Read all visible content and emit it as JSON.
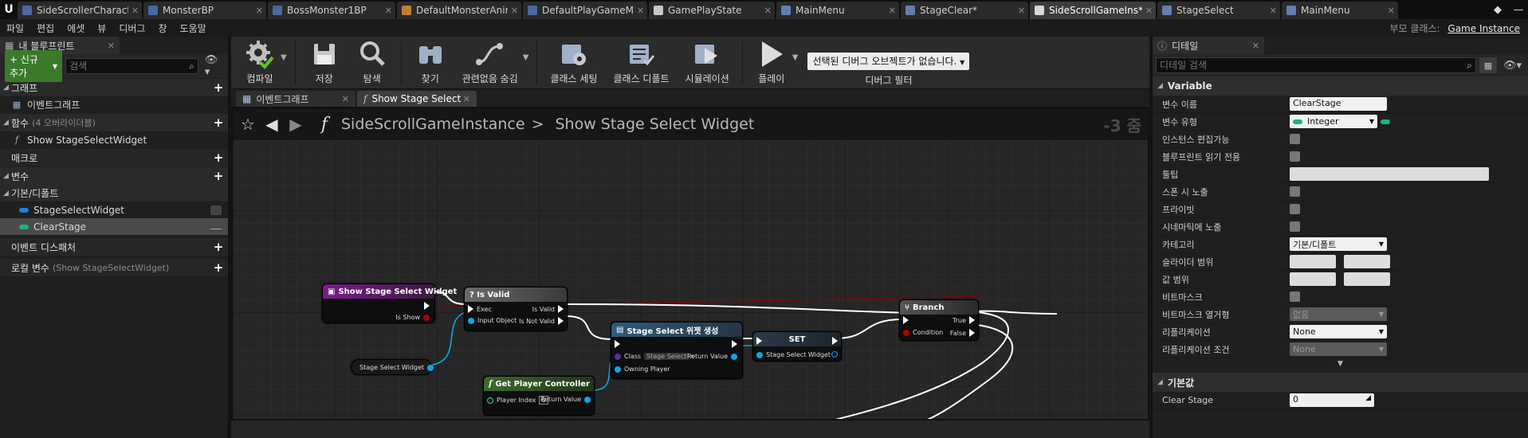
{
  "tabs": [
    {
      "label": "SideScrollerCharact",
      "color": "#4a6aa0"
    },
    {
      "label": "MonsterBP",
      "color": "#4a6aa0"
    },
    {
      "label": "BossMonster1BP",
      "color": "#4a6aa0"
    },
    {
      "label": "DefaultMonsterAnin",
      "color": "#c08030"
    },
    {
      "label": "DefaultPlayGameMo",
      "color": "#4a6aa0"
    },
    {
      "label": "GamePlayState",
      "color": "#c8c8c8"
    },
    {
      "label": "MainMenu",
      "color": "#6080b0"
    },
    {
      "label": "StageClear*",
      "color": "#6080b0"
    },
    {
      "label": "SideScrollGameIns*",
      "color": "#d8d8d8"
    },
    {
      "label": "StageSelect",
      "color": "#6080b0"
    },
    {
      "label": "MainMenu",
      "color": "#6080b0"
    }
  ],
  "menu": [
    "파일",
    "편집",
    "에셋",
    "뷰",
    "디버그",
    "창",
    "도움말"
  ],
  "parent_class": {
    "label": "부모 클래스:",
    "value": "Game Instance"
  },
  "left_panel": {
    "tab": "내 블루프린트",
    "add_new": "+ 신규 추가",
    "search_placeholder": "검색",
    "sections": {
      "graph": "그래프",
      "event_graph": "이벤트그래프",
      "functions": "함수",
      "functions_sub": "(4 오버라이더블)",
      "function_item": "Show StageSelectWidget",
      "macros": "매크로",
      "variables": "변수",
      "default_cat": "기본/디폴트",
      "var1": "StageSelectWidget",
      "var2": "ClearStage",
      "dispatchers": "이벤트 디스패처",
      "local_vars": "로컬 변수",
      "local_vars_sub": "(Show StageSelectWidget)"
    }
  },
  "toolbar": {
    "compile": "컴파일",
    "save": "저장",
    "browse": "탐색",
    "find": "찾기",
    "hide_unrelated": "관련없음 숨김",
    "class_settings": "클래스 세팅",
    "class_defaults": "클래스 디폴트",
    "simulation": "시뮬레이션",
    "play": "플레이",
    "debug_select": "선택된 디버그 오브젝트가 없습니다.",
    "debug_filter": "디버그 필터"
  },
  "graph_tabs": [
    "이벤트그래프",
    "Show Stage Select"
  ],
  "breadcrumb": {
    "root": "SideScrollGameInstance",
    "leaf": "Show Stage Select Widget",
    "zoom": "-3 줌"
  },
  "nodes": {
    "entry": {
      "title": "Show Stage Select Widget",
      "pin_isshow": "Is Show"
    },
    "isvalid": {
      "title": "? Is Valid",
      "exec": "Exec",
      "input": "Input Object",
      "is_valid": "Is Valid",
      "is_not_valid": "Is Not Valid"
    },
    "create": {
      "title": "Stage Select 위젯 생성",
      "class": "Class",
      "class_value": "Stage Select",
      "owning": "Owning Player",
      "ret": "Return Value"
    },
    "set": {
      "title": "SET",
      "pin": "Stage Select Widget"
    },
    "branch": {
      "title": "Branch",
      "cond": "Condition",
      "t": "True",
      "f": "False"
    },
    "getvar": {
      "title": "Stage Select Widget"
    },
    "getpc": {
      "title": "Get Player Controller",
      "idx": "Player Index",
      "idx_value": "0",
      "ret": "Return Value"
    }
  },
  "details": {
    "tab": "디테일",
    "search_placeholder": "디테일 검색",
    "cat_variable": "Variable",
    "props": {
      "var_name": {
        "label": "변수 이름",
        "value": "ClearStage"
      },
      "var_type": {
        "label": "변수 유형",
        "value": "Integer"
      },
      "instance_editable": "인스턴스 편집가능",
      "bp_readonly": "블루프린트 읽기 전용",
      "tooltip": "툴팁",
      "expose_spawn": "스폰 시 노출",
      "private": "프라이빗",
      "expose_cinematic": "시네마틱에 노출",
      "category": {
        "label": "카테고리",
        "value": "기본/디폴트"
      },
      "slider_range": "슬라이더 범위",
      "value_range": "값 범위",
      "bitmask": "비트마스크",
      "bitmask_enum": {
        "label": "비트마스크 열거형",
        "value": "없음"
      },
      "replication": {
        "label": "리플리케이션",
        "value": "None"
      },
      "rep_condition": {
        "label": "리플리케이션 조건",
        "value": "None"
      }
    },
    "cat_default": "기본값",
    "clear_stage": {
      "label": "Clear Stage",
      "value": "0"
    }
  },
  "colors": {
    "exec": "#ffffff",
    "object": "#0da5e6",
    "bool": "#8c0000",
    "int": "#1fe0a0",
    "function_header": "#7a1c8c",
    "pure_header": "#3b6b2a"
  }
}
